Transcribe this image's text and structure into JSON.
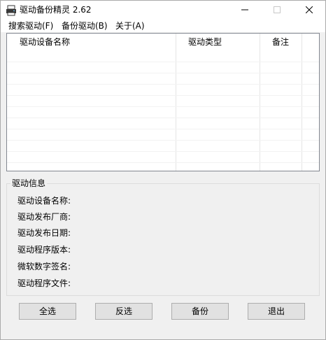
{
  "window": {
    "title": "驱动备份精灵 2.62",
    "icon": "printer-drive-icon",
    "controls": {
      "minimize": "minimize-icon",
      "maximize": "maximize-icon",
      "close": "close-icon"
    }
  },
  "menu": [
    "搜索驱动(F)",
    "备份驱动(B)",
    "关于(A)"
  ],
  "list": {
    "columns": [
      "驱动设备名称",
      "驱动类型",
      "备注"
    ],
    "rows": []
  },
  "info": {
    "title": "驱动信息",
    "labels": [
      "驱动设备名称:",
      "驱动发布厂商:",
      "驱动发布日期:",
      "驱动程序版本:",
      "微软数字签名:",
      "驱动程序文件:"
    ]
  },
  "buttons": [
    "全选",
    "反选",
    "备份",
    "退出"
  ],
  "colors": {
    "window_bg": "#f0f0f0",
    "button_bg": "#e1e1e1",
    "border": "#adadad"
  }
}
